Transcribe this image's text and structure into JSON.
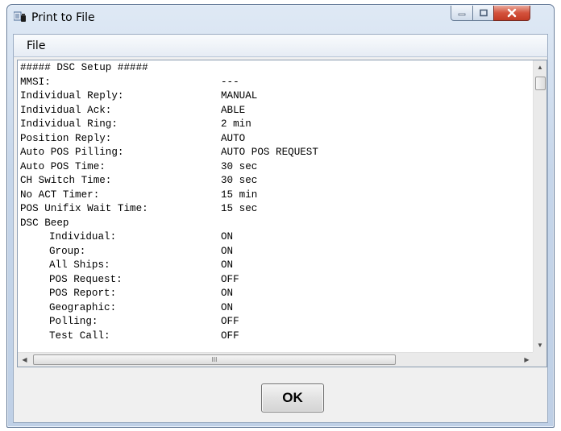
{
  "window": {
    "title": "Print to File",
    "controls": {
      "minimize": "─",
      "maximize": "▫",
      "close": "✕"
    }
  },
  "menu": {
    "file_label": "File"
  },
  "report": {
    "header": "##### DSC Setup #####",
    "settings": [
      {
        "key": "MMSI:",
        "value": "---"
      },
      {
        "key": "Individual Reply:",
        "value": "MANUAL"
      },
      {
        "key": "Individual Ack:",
        "value": "ABLE"
      },
      {
        "key": "Individual Ring:",
        "value": "2 min"
      },
      {
        "key": "Position Reply:",
        "value": "AUTO"
      },
      {
        "key": "Auto POS Pilling:",
        "value": "AUTO POS REQUEST"
      },
      {
        "key": "Auto POS Time:",
        "value": "30 sec"
      },
      {
        "key": "CH Switch Time:",
        "value": "30 sec"
      },
      {
        "key": "No ACT Timer:",
        "value": "15 min"
      },
      {
        "key": "POS Unifix Wait Time:",
        "value": "15 sec"
      }
    ],
    "beep_section": "DSC Beep",
    "beep_settings": [
      {
        "key": "Individual:",
        "value": "ON"
      },
      {
        "key": "Group:",
        "value": "ON"
      },
      {
        "key": "All Ships:",
        "value": "ON"
      },
      {
        "key": "POS Request:",
        "value": "OFF"
      },
      {
        "key": "POS Report:",
        "value": "ON"
      },
      {
        "key": "Geographic:",
        "value": "ON"
      },
      {
        "key": "Polling:",
        "value": "OFF"
      },
      {
        "key": "Test Call:",
        "value": "OFF"
      }
    ]
  },
  "scroll": {
    "up_arrow": "▲",
    "down_arrow": "▼",
    "left_arrow": "◀",
    "right_arrow": "▶",
    "grip": "III"
  },
  "buttons": {
    "ok_label": "OK"
  }
}
